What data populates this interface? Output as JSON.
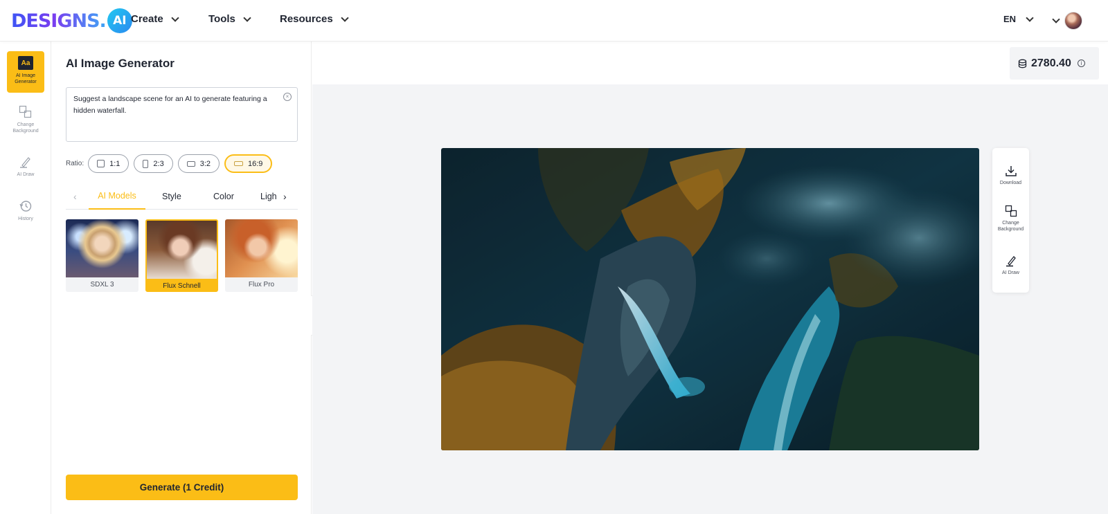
{
  "header": {
    "logo_text": "DESIGNS.",
    "logo_badge": "AI",
    "nav": [
      {
        "label": "Create"
      },
      {
        "label": "Tools"
      },
      {
        "label": "Resources"
      }
    ],
    "language": "EN"
  },
  "rail": {
    "items": [
      {
        "label": "AI Image Generator",
        "icon": "aa-icon",
        "active": true
      },
      {
        "label": "Change Background",
        "icon": "change-background-icon"
      },
      {
        "label": "AI Draw",
        "icon": "pen-icon"
      },
      {
        "label": "History",
        "icon": "history-icon"
      }
    ]
  },
  "panel": {
    "title": "AI Image Generator",
    "prompt": "Suggest a landscape scene for an AI to generate featuring a hidden waterfall.",
    "ratio_label": "Ratio:",
    "ratios": [
      {
        "label": "1:1"
      },
      {
        "label": "2:3"
      },
      {
        "label": "3:2"
      },
      {
        "label": "16:9",
        "selected": true
      }
    ],
    "tabs": [
      {
        "label": "AI Models",
        "active": true
      },
      {
        "label": "Style"
      },
      {
        "label": "Color"
      },
      {
        "label": "Ligh"
      }
    ],
    "models": [
      {
        "label": "SDXL 3"
      },
      {
        "label": "Flux Schnell",
        "selected": true
      },
      {
        "label": "Flux Pro"
      }
    ],
    "generate_label": "Generate (1 Credit)"
  },
  "credits": {
    "value": "2780.40"
  },
  "actions": [
    {
      "label": "Download",
      "icon": "download-icon"
    },
    {
      "label": "Change Background",
      "icon": "change-background-icon"
    },
    {
      "label": "AI Draw",
      "icon": "pen-icon"
    }
  ],
  "colors": {
    "accent": "#fbbd16",
    "brand": "#5b3cf0",
    "canvas_bg": "#f3f4f6"
  }
}
